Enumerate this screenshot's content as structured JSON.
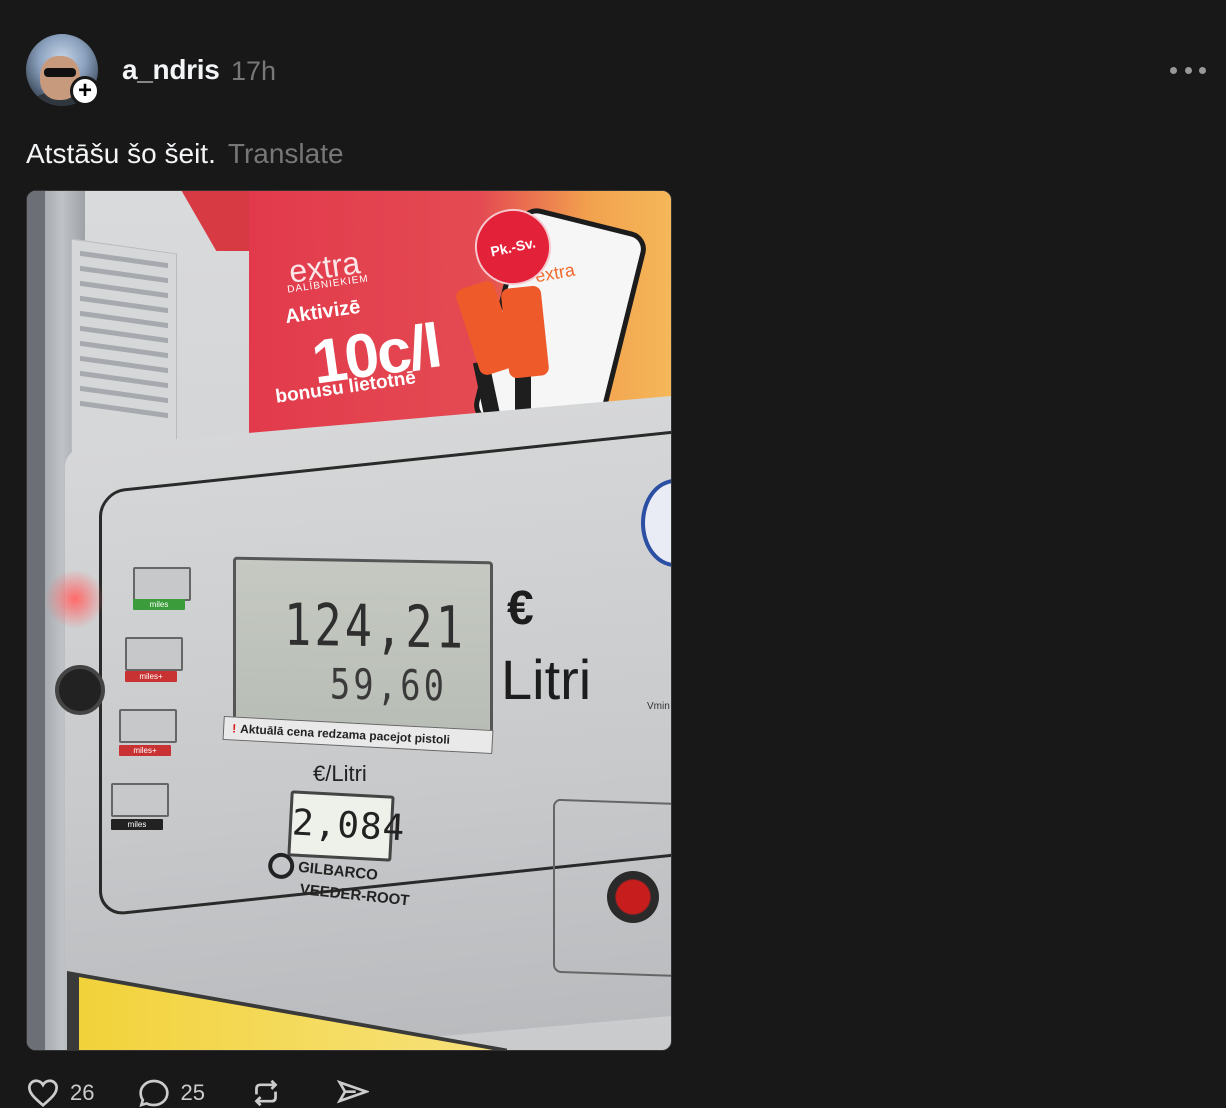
{
  "post": {
    "username": "a_ndris",
    "time": "17h",
    "caption": "Atstāšu šo šeit.",
    "translate_label": "Translate",
    "follow_symbol": "+"
  },
  "photo": {
    "ad": {
      "extra": "extra",
      "sub": "DALĪBNIEKIEM",
      "activize": "Aktivizē",
      "discount": "10c/l",
      "bonus": "bonusu lietotnē",
      "badge": "Pk.-Sv.",
      "phone_logo": "extra"
    },
    "pump": {
      "amount": "124,21",
      "currency": "€",
      "litres": "59,60",
      "litres_label": "Litri",
      "warning": "Aktuālā cena redzama pacejot pistoli",
      "price_label": "€/Litri",
      "price_per_litre": "2,084",
      "brand_line1": "GILBARCO",
      "brand_line2": "VEEDER-ROOT",
      "vmin": "Vmin",
      "miles_labels": [
        "miles",
        "miles+",
        "miles+",
        "miles"
      ]
    }
  },
  "actions": {
    "likes": "26",
    "replies": "25"
  },
  "colors": {
    "background": "#181818",
    "text": "#f3f5f7",
    "muted": "#777777"
  },
  "icons": [
    "more-icon",
    "heart-icon",
    "comment-icon",
    "repost-icon",
    "share-icon",
    "plus-icon"
  ]
}
